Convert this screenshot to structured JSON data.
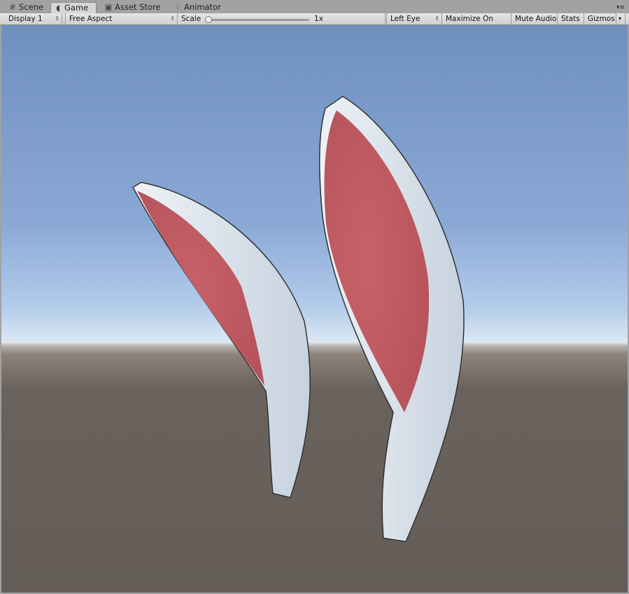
{
  "tabs": [
    {
      "label": "Scene",
      "icon": "grid-icon"
    },
    {
      "label": "Game",
      "icon": "pacman-icon"
    },
    {
      "label": "Asset Store",
      "icon": "store-icon"
    },
    {
      "label": "Animator",
      "icon": "animator-icon"
    }
  ],
  "toolbar": {
    "display": "Display 1",
    "aspect": "Free Aspect",
    "scale_label": "Scale",
    "scale_value": "1x",
    "eye": "Left Eye",
    "maximize": "Maximize On Play",
    "mute": "Mute Audio",
    "stats": "Stats",
    "gizmos": "Gizmos"
  },
  "colors": {
    "sky": "#6f8fbf",
    "ground": "#6a625c",
    "fur": "#dfe6ee",
    "inner": "#c9646a"
  }
}
